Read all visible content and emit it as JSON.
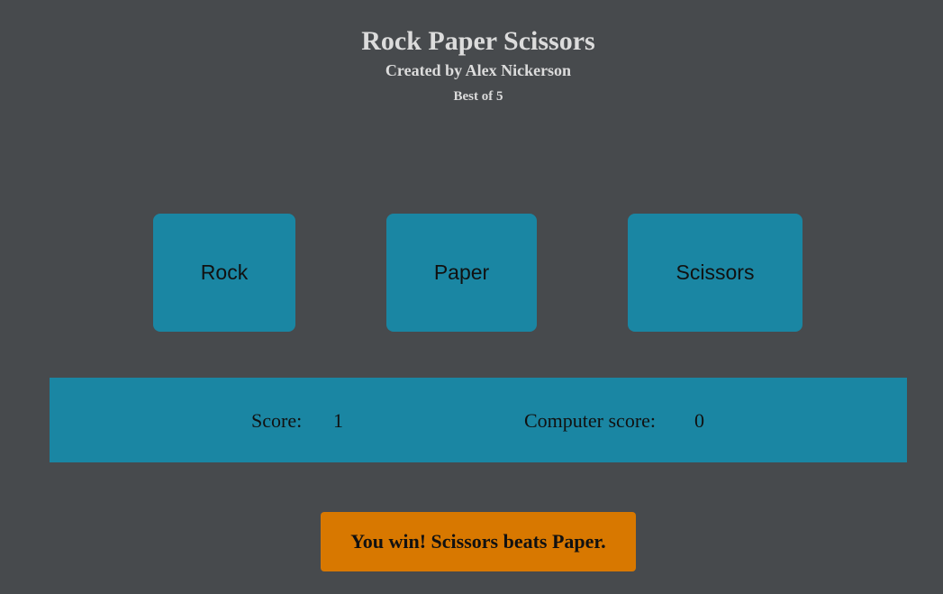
{
  "header": {
    "title": "Rock Paper Scissors",
    "subtitle": "Created by Alex Nickerson",
    "mode": "Best of 5"
  },
  "choices": [
    {
      "label": "Rock"
    },
    {
      "label": "Paper"
    },
    {
      "label": "Scissors"
    }
  ],
  "scoreboard": {
    "player_label": "Score:",
    "player_score": "1",
    "computer_label": "Computer score:",
    "computer_score": "0"
  },
  "result": {
    "message": "You win! Scissors beats Paper."
  },
  "colors": {
    "background": "#474a4d",
    "accent": "#1a86a3",
    "result": "#d87800",
    "heading_text": "#dcdcdc"
  }
}
